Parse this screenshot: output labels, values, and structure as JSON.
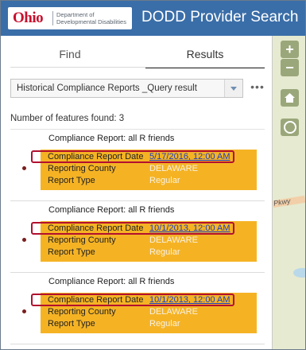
{
  "header": {
    "logo_text": "Ohio",
    "logo_department": "Department of Developmental Disabilities",
    "title": "DODD Provider Search"
  },
  "tabs": [
    {
      "label": "Find",
      "active": false
    },
    {
      "label": "Results",
      "active": true
    }
  ],
  "layer_select": {
    "selected": "Historical Compliance Reports _Query result"
  },
  "more_icon": "ellipsis-icon",
  "features_count_text": "Number of features found: 3",
  "features": [
    {
      "title": "Compliance Report: all R friends",
      "attributes": [
        {
          "label": "Compliance Report Date",
          "value": "5/17/2016, 12:00 AM"
        },
        {
          "label": "Reporting County",
          "value": "DELAWARE"
        },
        {
          "label": "Report Type",
          "value": "Regular"
        }
      ]
    },
    {
      "title": "Compliance Report: all R friends",
      "attributes": [
        {
          "label": "Compliance Report Date",
          "value": "10/1/2013, 12:00 AM"
        },
        {
          "label": "Reporting County",
          "value": "DELAWARE"
        },
        {
          "label": "Report Type",
          "value": "Regular"
        }
      ]
    },
    {
      "title": "Compliance Report: all R friends",
      "attributes": [
        {
          "label": "Compliance Report Date",
          "value": "10/1/2013, 12:00 AM"
        },
        {
          "label": "Reporting County",
          "value": "DELAWARE"
        },
        {
          "label": "Report Type",
          "value": "Regular"
        }
      ]
    }
  ],
  "map": {
    "road_label": "Pkwy",
    "controls": [
      "zoom-in-icon",
      "zoom-out-icon",
      "home-icon",
      "locate-icon"
    ]
  },
  "colors": {
    "header_bg": "#3a6ea8",
    "attribute_highlight": "#f5b324",
    "annotation_border": "#b2102f",
    "link": "#1a3fc4"
  }
}
